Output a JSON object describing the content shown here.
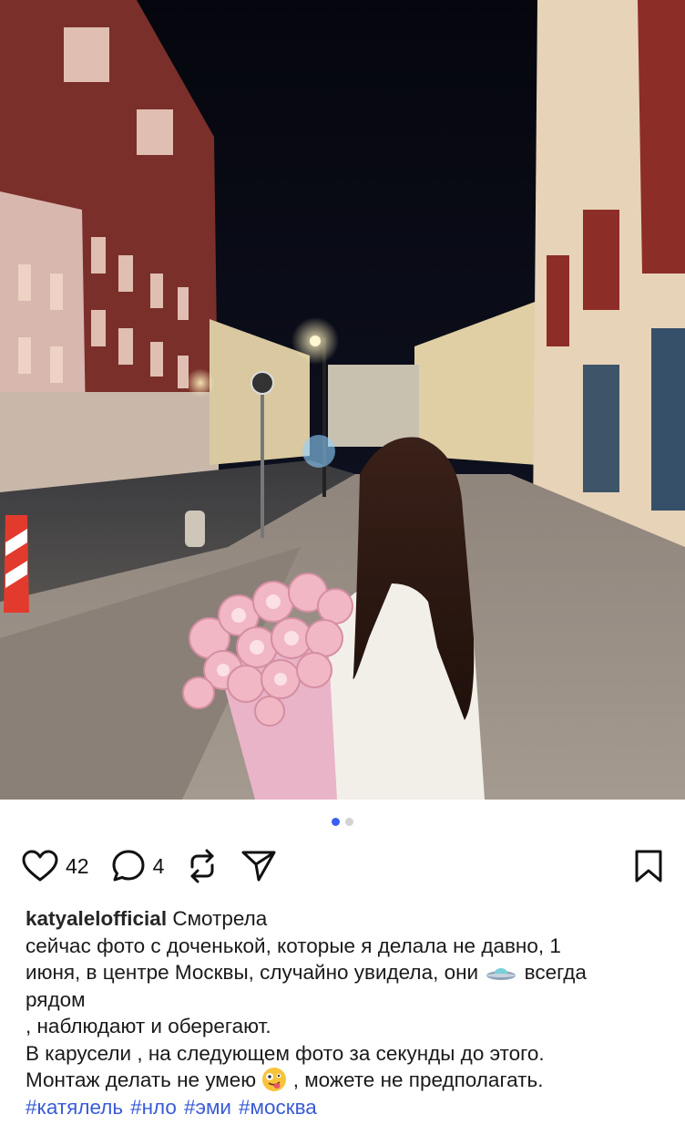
{
  "post": {
    "likes": "42",
    "comments": "4",
    "carousel": {
      "total": 2,
      "current": 1
    }
  },
  "caption": {
    "username": "katyalelofficial",
    "first_word": "Смотрела",
    "line1": "сейчас фото с доченькой, которые я делала не давно, 1",
    "line2_a": "июня, в центре Москвы, случайно увидела, они",
    "line2_b": "всегда",
    "line3": "рядом",
    "line4": ", наблюдают и оберегают.",
    "line5": "В карусели , на следующем фото за секунды до этого.",
    "line6_a": "Монтаж делать не умею",
    "line6_b": ", можете не предполагать.",
    "hashtags": [
      "#катялель",
      "#нло",
      "#эми",
      "#москва"
    ]
  },
  "icons": {
    "like": "heart-icon",
    "comment": "comment-bubble-icon",
    "repost": "repost-icon",
    "share": "send-paper-plane-icon",
    "save": "bookmark-icon",
    "inline_emoji_1": "flying-saucer-emoji",
    "inline_emoji_2": "zany-face-emoji"
  },
  "colors": {
    "hashtag": "#3a5bd6",
    "carousel_active": "#3b5ff0",
    "carousel_inactive": "#d3d3d3"
  }
}
